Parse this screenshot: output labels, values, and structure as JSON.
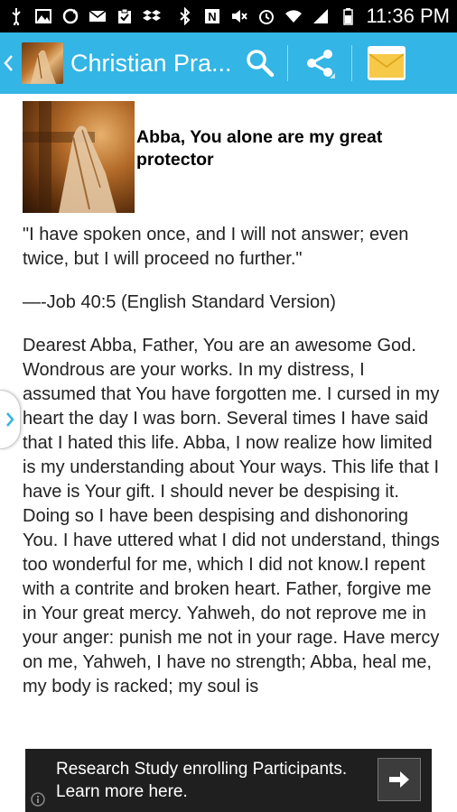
{
  "status_bar": {
    "time": "11:36 PM",
    "icons": [
      "usb-icon",
      "image-icon",
      "sync-icon",
      "mail-icon",
      "clipboard-icon",
      "dropbox-icon",
      "bluetooth-icon",
      "nfc-icon",
      "mute-icon",
      "alarm-icon",
      "wifi-icon",
      "signal-icon",
      "battery-icon"
    ]
  },
  "action_bar": {
    "title": "Christian Pra...",
    "actions": [
      "search-icon",
      "share-icon",
      "mail-icon"
    ],
    "color": "#33b5e5"
  },
  "article": {
    "title": "Abba, You alone are my great protector",
    "quote": "\"I have spoken once, and I will not answer; even twice, but I will proceed no further.\"",
    "reference": "—-Job 40:5 (English Standard Version)",
    "body": "Dearest Abba, Father, You are an awesome God. Wondrous are your works. In my distress, I assumed that You have forgotten me. I cursed in my heart the day I was born. Several times I have said that I hated this life. Abba, I now realize how limited is my understanding about Your ways. This life that I have is Your gift. I should never be despising it. Doing so I have been despising and dishonoring You. I have uttered what I did not understand, things too wonderful for me, which I did not know.I repent with a contrite and broken heart. Father, forgive me in Your great mercy. Yahweh, do not reprove me in your anger: punish me not in your rage. Have mercy on me, Yahweh, I have no strength; Abba, heal me, my body is racked; my soul is"
  },
  "ad": {
    "text": "Research Study enrolling Participants. Learn more here."
  }
}
